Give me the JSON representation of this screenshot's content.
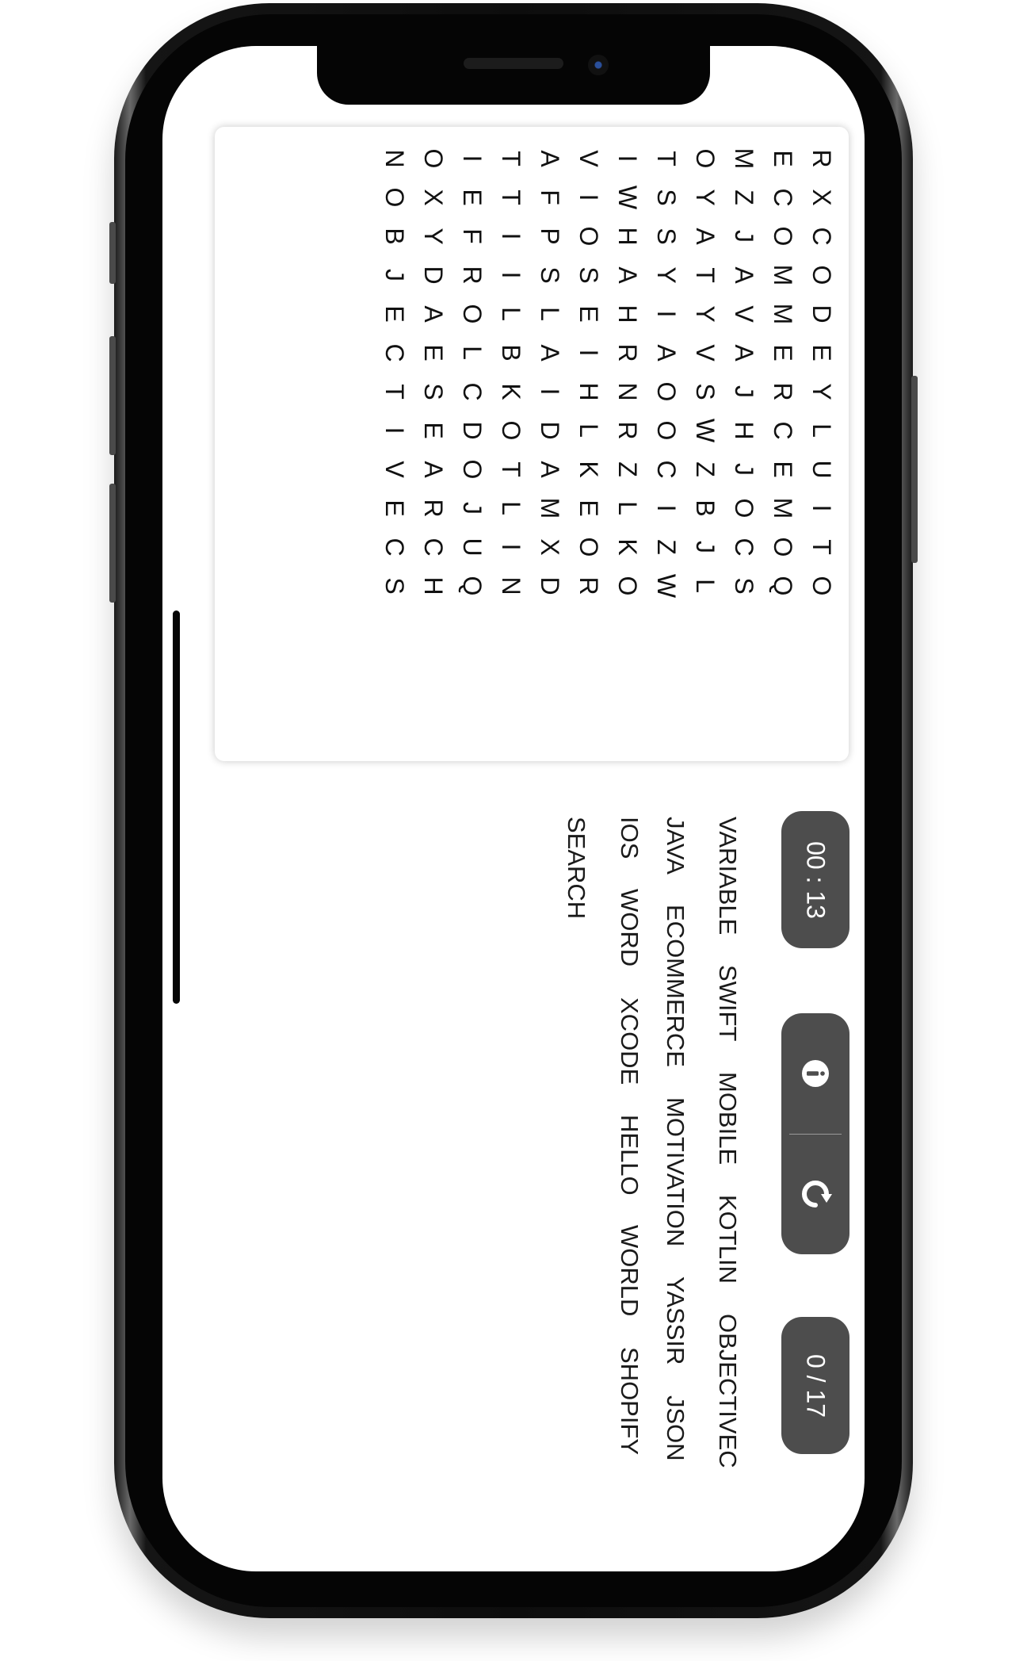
{
  "grid": {
    "columns": [
      [
        "R",
        "X",
        "C",
        "O",
        "D",
        "E",
        "Y",
        "L",
        "U",
        "I",
        "T",
        "O"
      ],
      [
        "E",
        "C",
        "O",
        "M",
        "M",
        "E",
        "R",
        "C",
        "E",
        "M",
        "O",
        "Q"
      ],
      [
        "M",
        "Z",
        "J",
        "A",
        "V",
        "A",
        "J",
        "H",
        "J",
        "O",
        "C",
        "S"
      ],
      [
        "O",
        "Y",
        "A",
        "T",
        "Y",
        "V",
        "S",
        "W",
        "Z",
        "B",
        "J",
        "L"
      ],
      [
        "T",
        "S",
        "S",
        "Y",
        "I",
        "A",
        "O",
        "O",
        "C",
        "I",
        "Z",
        "W"
      ],
      [
        "I",
        "W",
        "H",
        "A",
        "H",
        "R",
        "N",
        "R",
        "Z",
        "L",
        "K",
        "O"
      ],
      [
        "V",
        "I",
        "O",
        "S",
        "E",
        "I",
        "H",
        "L",
        "K",
        "E",
        "O",
        "R"
      ],
      [
        "A",
        "F",
        "P",
        "S",
        "L",
        "A",
        "I",
        "D",
        "A",
        "M",
        "X",
        "D"
      ],
      [
        "T",
        "T",
        "I",
        "I",
        "L",
        "B",
        "K",
        "O",
        "T",
        "L",
        "I",
        "N"
      ],
      [
        "I",
        "E",
        "F",
        "R",
        "O",
        "L",
        "C",
        "D",
        "O",
        "J",
        "U",
        "Q"
      ],
      [
        "O",
        "X",
        "Y",
        "D",
        "A",
        "E",
        "S",
        "E",
        "A",
        "R",
        "C",
        "H"
      ],
      [
        "N",
        "O",
        "B",
        "J",
        "E",
        "C",
        "T",
        "I",
        "V",
        "E",
        "C",
        "S"
      ]
    ]
  },
  "timer": {
    "value": "00 : 13"
  },
  "score": {
    "value": "0 / 17"
  },
  "actions": {
    "info_icon": "info-icon",
    "refresh_icon": "refresh-icon"
  },
  "words": [
    [
      "VARIABLE",
      "SWIFT",
      "MOBILE",
      "KOTLIN",
      "OBJECTIVEC"
    ],
    [
      "JAVA",
      "ECOMMERCE",
      "MOTIVATION",
      "YASSIR",
      "JSON"
    ],
    [
      "IOS",
      "WORD",
      "XCODE",
      "HELLO",
      "WORLD",
      "SHOPIFY"
    ],
    [
      "SEARCH"
    ]
  ]
}
